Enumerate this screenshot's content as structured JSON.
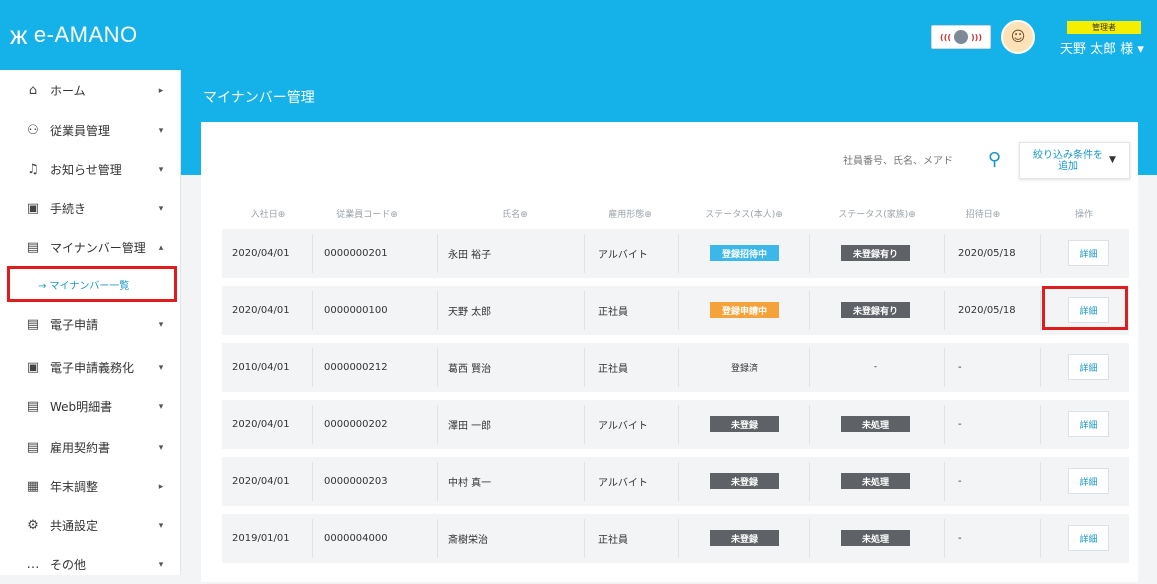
{
  "header": {
    "logo_text": "e-AMANO",
    "role_tag": "管理者",
    "user_name": "天野 太郎 様 ▾"
  },
  "sidebar": {
    "items": [
      {
        "label": "ホーム",
        "icon": "home-icon",
        "arrow": "▸"
      },
      {
        "label": "従業員管理",
        "icon": "people-icon",
        "arrow": "▾"
      },
      {
        "label": "お知らせ管理",
        "icon": "bell-icon",
        "arrow": "▾"
      },
      {
        "label": "手続き",
        "icon": "clipboard-icon",
        "arrow": "▾"
      },
      {
        "label": "マイナンバー管理",
        "icon": "id-card-icon",
        "arrow": "▴"
      },
      {
        "label": "電子申請",
        "icon": "document-icon",
        "arrow": "▾"
      },
      {
        "label": "電子申請義務化",
        "icon": "document-icon",
        "arrow": "▾"
      },
      {
        "label": "Web明細書",
        "icon": "document-icon",
        "arrow": "▾"
      },
      {
        "label": "雇用契約書",
        "icon": "document-icon",
        "arrow": "▾"
      },
      {
        "label": "年末調整",
        "icon": "calculator-icon",
        "arrow": "▸"
      },
      {
        "label": "共通設定",
        "icon": "gear-icon",
        "arrow": "▾"
      },
      {
        "label": "その他",
        "icon": "more-icon",
        "arrow": "▾"
      }
    ],
    "subitem": "→ マイナンバー一覧"
  },
  "main": {
    "page_title": "マイナンバー管理",
    "search_placeholder": "社員番号、氏名、メアド",
    "filter_label_line1": "絞り込み条件を",
    "filter_label_line2": "追加"
  },
  "table": {
    "headers": [
      "入社日⊕",
      "従業員コード⊕",
      "氏名⊕",
      "雇用形態⊕",
      "ステータス(本人)⊕",
      "ステータス(家族)⊕",
      "招待日⊕",
      "操作"
    ],
    "rows": [
      {
        "date": "2020/04/01",
        "code": "0000000201",
        "name": "永田 裕子",
        "type": "アルバイト",
        "self": "登録招待中",
        "self_style": "blue",
        "family": "未登録有り",
        "family_style": "dark",
        "invite": "2020/05/18",
        "action": "詳細"
      },
      {
        "date": "2020/04/01",
        "code": "0000000100",
        "name": "天野 太郎",
        "type": "正社員",
        "self": "登録申請中",
        "self_style": "orange",
        "family": "未登録有り",
        "family_style": "dark",
        "invite": "2020/05/18",
        "action": "詳細"
      },
      {
        "date": "2010/04/01",
        "code": "0000000212",
        "name": "葛西 賢治",
        "type": "正社員",
        "self": "登録済",
        "self_style": "plain",
        "family": "-",
        "family_style": "plain",
        "invite": "-",
        "action": "詳細"
      },
      {
        "date": "2020/04/01",
        "code": "0000000202",
        "name": "澤田 一郎",
        "type": "アルバイト",
        "self": "未登録",
        "self_style": "dark",
        "family": "未処理",
        "family_style": "dark",
        "invite": "-",
        "action": "詳細"
      },
      {
        "date": "2020/04/01",
        "code": "0000000203",
        "name": "中村 真一",
        "type": "アルバイト",
        "self": "未登録",
        "self_style": "dark",
        "family": "未処理",
        "family_style": "dark",
        "invite": "-",
        "action": "詳細"
      },
      {
        "date": "2019/01/01",
        "code": "0000004000",
        "name": "斎樹栄治",
        "type": "正社員",
        "self": "未登録",
        "self_style": "dark",
        "family": "未処理",
        "family_style": "dark",
        "invite": "-",
        "action": "詳細"
      }
    ]
  }
}
